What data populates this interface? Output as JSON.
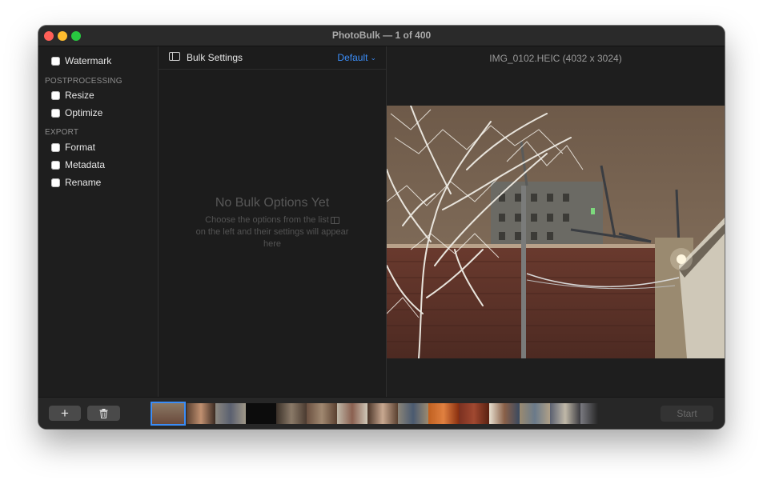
{
  "window": {
    "title": "PhotoBulk — 1 of 400"
  },
  "sidebar": {
    "items": [
      {
        "label": "Watermark"
      }
    ],
    "sections": [
      {
        "title": "POSTPROCESSING",
        "items": [
          {
            "label": "Resize"
          },
          {
            "label": "Optimize"
          }
        ]
      },
      {
        "title": "EXPORT",
        "items": [
          {
            "label": "Format"
          },
          {
            "label": "Metadata"
          },
          {
            "label": "Rename"
          }
        ]
      }
    ]
  },
  "middle": {
    "title": "Bulk Settings",
    "preset": "Default",
    "empty_title": "No Bulk Options Yet",
    "empty_desc_part1": "Choose the options from the list",
    "empty_desc_part2": "on the left and their settings will appear here"
  },
  "preview": {
    "file_info": "IMG_0102.HEIC (4032 x 3024)"
  },
  "bottom": {
    "add_label": "+",
    "start_label": "Start"
  },
  "icons": {
    "panel": "sidebar-panel-icon",
    "chevron": "chevron-down-icon",
    "trash": "trash-icon"
  },
  "colors": {
    "accent": "#3b8df7",
    "window_bg": "#1e1e1e"
  }
}
